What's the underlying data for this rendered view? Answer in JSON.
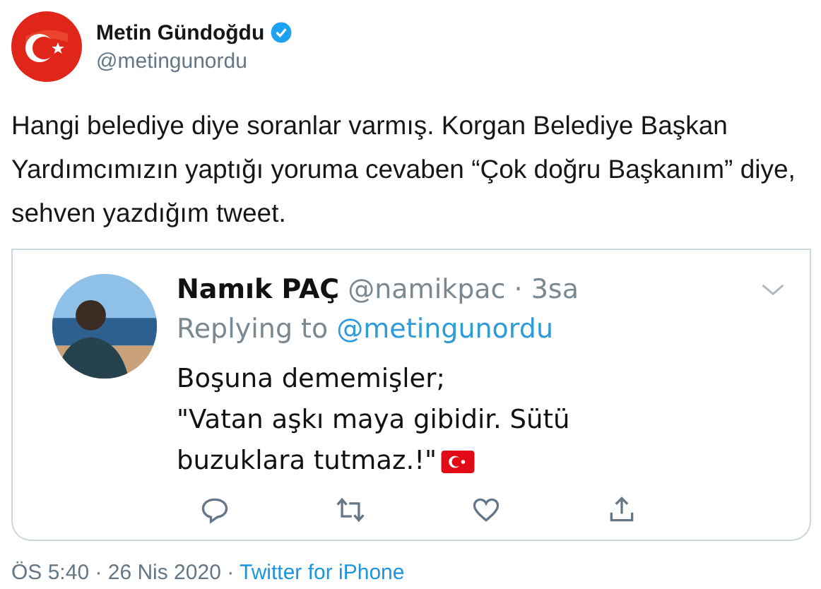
{
  "author": {
    "name": "Metin Gündoğdu",
    "handle": "@metingunordu",
    "verified": true
  },
  "text": "Hangi belediye diye soranlar varmış. Korgan Belediye Başkan Yardımcımızın yaptığı yoruma cevaben “Çok doğru  Başkanım” diye, sehven yazdığım tweet.",
  "quoted": {
    "author": {
      "name": "Namık PAÇ",
      "handle": "@namikpac",
      "time": "· 3sa"
    },
    "replying_label": "Replying to",
    "replying_to": "@metingunordu",
    "lines": [
      "Boşuna dememişler;",
      "\"Vatan aşkı maya gibidir. Sütü",
      "buzuklara tutmaz.!\""
    ]
  },
  "footer": {
    "time_date": "ÖS 5:40 · 26 Nis 2020 ·",
    "source": "Twitter for iPhone"
  }
}
